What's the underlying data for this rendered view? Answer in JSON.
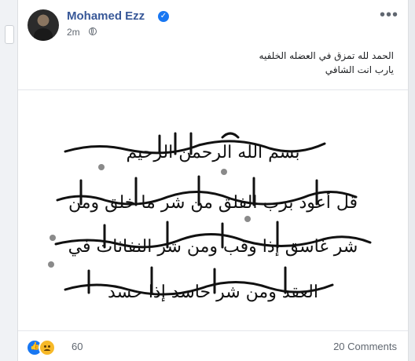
{
  "post": {
    "author": "Mohamed Ezz",
    "time": "2m",
    "caption_lines": [
      "الحمد لله تمزق في العضله الخلفيه",
      "يارب انت الشافي"
    ]
  },
  "image": {
    "lines": [
      "بسم الله الرحمن الرحيم",
      "قل أعوذ برب الفلق من شر ما خلق ومن",
      "شر غاسق إذا وقب ومن شر النفاثات في",
      "العقد ومن شر حاسد إذا حسد"
    ]
  },
  "footer": {
    "reaction_count": "60",
    "comments": "20 Comments"
  },
  "colors": {
    "name_blue": "#385898",
    "verified_blue": "#1877f2"
  }
}
